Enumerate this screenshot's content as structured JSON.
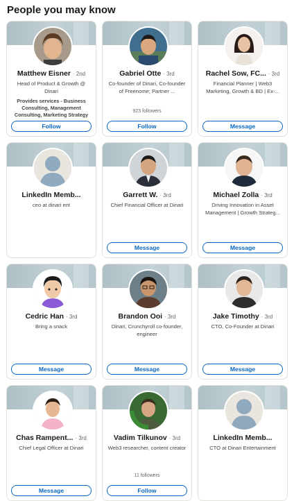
{
  "heading": "People you may know",
  "cards": [
    {
      "name": "Matthew Eisner",
      "degree": "· 2nd",
      "headline": "Head of Product & Growth @ Dinari",
      "services_bold": "Provides services - Business Consulting, Management Consulting, Marketing Strategy",
      "followers": "",
      "button": "Follow",
      "avatar": "photo-man-curly-hair"
    },
    {
      "name": "Gabriel Otte",
      "degree": "· 3rd",
      "headline": "Co-founder of Dinari, Co-founder of Freenome; Partner ...",
      "services_bold": "",
      "followers": "923 followers",
      "button": "Follow",
      "avatar": "photo-man-outdoor"
    },
    {
      "name": "Rachel Sow, FC...",
      "degree": "· 3rd",
      "headline": "Financial Planner | Web3 Marketing, Growth & BD | Ex-...",
      "services_bold": "",
      "followers": "",
      "button": "Message",
      "avatar": "photo-woman-white-bg"
    },
    {
      "name": "LinkedIn Memb...",
      "degree": "",
      "headline": "ceo at dinari ent",
      "services_bold": "",
      "followers": "",
      "button": "",
      "avatar": "placeholder-person-icon"
    },
    {
      "name": "Garrett W.",
      "degree": "· 3rd",
      "headline": "Chief Financial Officer at Dinari",
      "services_bold": "",
      "followers": "",
      "button": "Message",
      "avatar": "photo-man-suit"
    },
    {
      "name": "Michael Zolla",
      "degree": "· 3rd",
      "headline": "Driving Innovation in Asset Management | Growth Strateg...",
      "services_bold": "",
      "followers": "",
      "button": "Message",
      "avatar": "photo-man-smiling"
    },
    {
      "name": "Cedric Han",
      "degree": "· 3rd",
      "headline": "Bring a snack",
      "services_bold": "",
      "followers": "",
      "button": "Message",
      "avatar": "illustrated-avatar"
    },
    {
      "name": "Brandon Ooi",
      "degree": "· 3rd",
      "headline": "Dinari, Crunchyroll co-founder, engineer",
      "services_bold": "",
      "followers": "",
      "button": "Message",
      "avatar": "photo-man-glasses"
    },
    {
      "name": "Jake Timothy",
      "degree": "· 3rd",
      "headline": "CTO, Co-Founder at Dinari",
      "services_bold": "",
      "followers": "",
      "button": "Message",
      "avatar": "photo-man-dark-bg"
    },
    {
      "name": "Chas Rampent...",
      "degree": "· 3rd",
      "headline": "Chief Legal Officer at Dinari",
      "services_bold": "",
      "followers": "",
      "button": "Message",
      "avatar": "photo-man-pink-shirt"
    },
    {
      "name": "Vadim Tilkunov",
      "degree": "· 3rd",
      "headline": "Web3 researcher, content creator",
      "services_bold": "",
      "followers": "11 followers",
      "button": "Follow",
      "avatar": "photo-opentowork"
    },
    {
      "name": "LinkedIn Memb...",
      "degree": "",
      "headline": "CTO at Dinari Entertainment",
      "services_bold": "",
      "followers": "",
      "button": "",
      "avatar": "placeholder-person-icon"
    }
  ],
  "opentowork_label": "#OPENTOWORK",
  "colors": {
    "accent": "#0a66c2",
    "banner": "#b7c8ce"
  }
}
